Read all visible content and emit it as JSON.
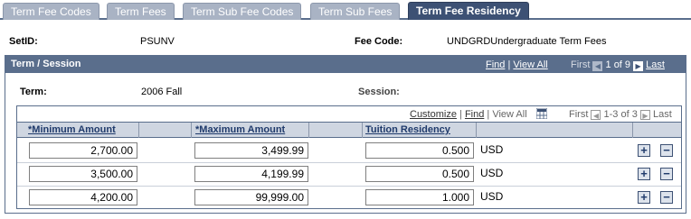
{
  "tabs": [
    {
      "label": "Term Fee Codes",
      "active": false
    },
    {
      "label": "Term Fees",
      "active": false
    },
    {
      "label": "Term Sub Fee Codes",
      "active": false
    },
    {
      "label": "Term Sub Fees",
      "active": false
    },
    {
      "label": "Term Fee Residency",
      "active": true
    }
  ],
  "header": {
    "setid_label": "SetID:",
    "setid_value": "PSUNV",
    "fee_code_label": "Fee Code:",
    "fee_code_value": "UNDGRDUndergraduate Term Fees"
  },
  "term_session": {
    "title": "Term / Session",
    "find": "Find",
    "sep": "|",
    "view_all": "View All",
    "first": "First",
    "counter": "1 of 9",
    "last": "Last",
    "term_label": "Term:",
    "term_value": "2006 Fall",
    "session_label": "Session:"
  },
  "grid": {
    "customize": "Customize",
    "find": "Find",
    "view_all": "View All",
    "first": "First",
    "counter": "1-3 of 3",
    "last": "Last",
    "col_min": "*Minimum Amount",
    "col_max": "*Maximum Amount",
    "col_residency": "Tuition Residency",
    "rows": [
      {
        "min": "2,700.00",
        "max": "3,499.99",
        "residency": "0.500",
        "currency": "USD"
      },
      {
        "min": "3,500.00",
        "max": "4,199.99",
        "residency": "0.500",
        "currency": "USD"
      },
      {
        "min": "4,200.00",
        "max": "99,999.00",
        "residency": "1.000",
        "currency": "USD"
      }
    ]
  },
  "icons": {
    "add": "+",
    "remove": "−",
    "prev": "◀",
    "next": "▶"
  }
}
